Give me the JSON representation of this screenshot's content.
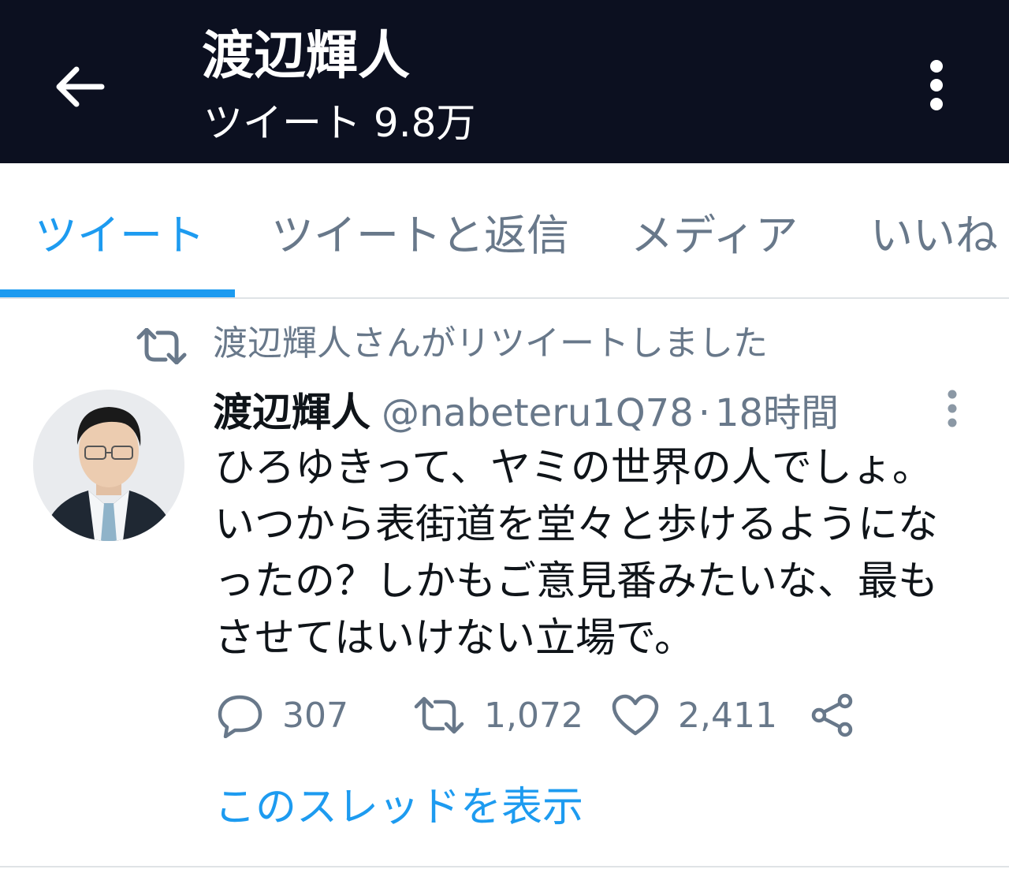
{
  "header": {
    "title": "渡辺輝人",
    "tweet_count": "ツイート 9.8万"
  },
  "tabs": [
    {
      "label": "ツイート",
      "active": true
    },
    {
      "label": "ツイートと返信",
      "active": false
    },
    {
      "label": "メディア",
      "active": false
    },
    {
      "label": "いいね",
      "active": false
    }
  ],
  "tweet": {
    "retweet_label": "渡辺輝人さんがリツイートしました",
    "author": "渡辺輝人",
    "handle": "@nabeteru1Q78",
    "separator": "·",
    "time": "18時間",
    "text_lines": [
      "ひろゆきって、ヤミの世界の人でしょ。",
      "いつから表街道を堂々と歩けるようにな",
      "ったの？しかもご意見番みたいな、最も",
      "させてはいけない立場で。"
    ],
    "replies": "307",
    "retweets": "1,072",
    "likes": "2,411",
    "thread_link": "このスレッドを表示"
  },
  "colors": {
    "header_bg": "#0c1020",
    "accent": "#1d9bf0",
    "muted": "#68788a",
    "text": "#0f1419"
  }
}
